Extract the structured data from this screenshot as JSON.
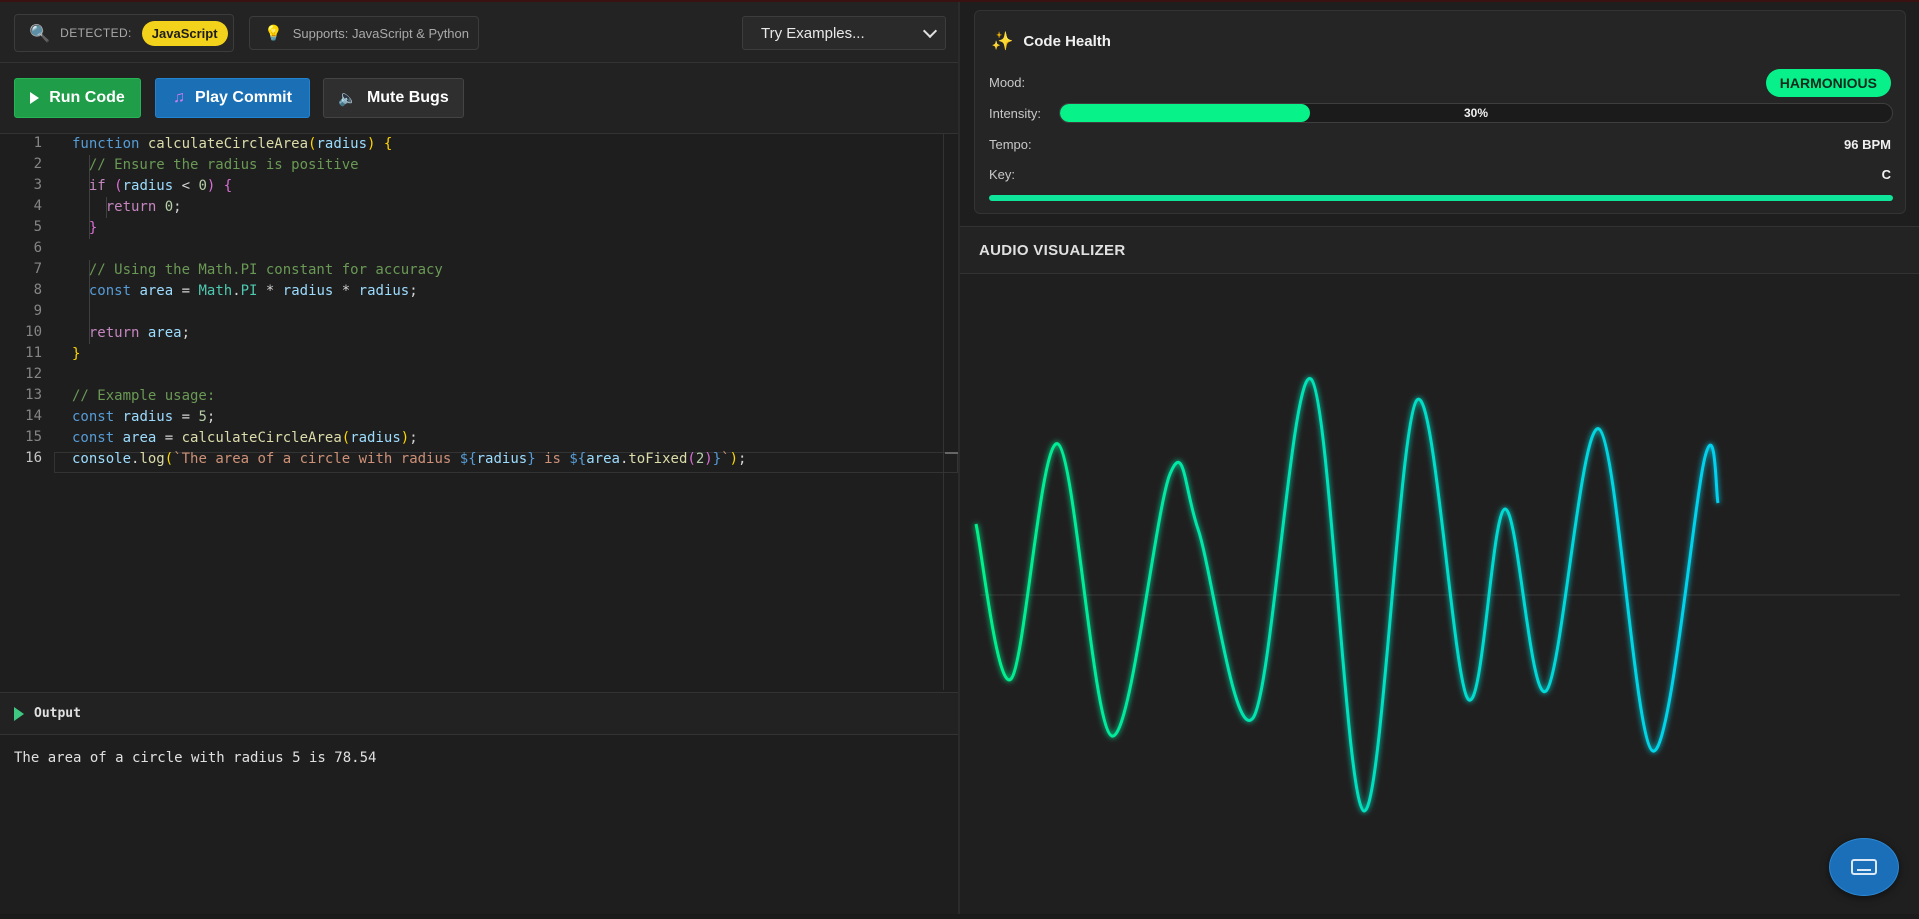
{
  "toolbar_top": {
    "detected_label": "DETECTED:",
    "detected_language": "JavaScript",
    "supports_label": "Supports: JavaScript & Python",
    "examples_select": "Try Examples..."
  },
  "actions": {
    "run": "Run Code",
    "play": "Play Commit",
    "mute": "Mute Bugs"
  },
  "editor": {
    "line_numbers": [
      "1",
      "2",
      "3",
      "4",
      "5",
      "6",
      "7",
      "8",
      "9",
      "10",
      "11",
      "12",
      "13",
      "14",
      "15",
      "16"
    ],
    "active_line": 16
  },
  "output": {
    "title": "Output",
    "text": "The area of a circle with radius 5 is 78.54"
  },
  "code_health": {
    "title": "Code Health",
    "mood_label": "Mood:",
    "mood_value": "HARMONIOUS",
    "intensity_label": "Intensity:",
    "intensity_value": "30%",
    "intensity_fraction": 0.3,
    "tempo_label": "Tempo:",
    "tempo_value": "96 BPM",
    "key_label": "Key:",
    "key_value": "C"
  },
  "visualizer": {
    "title": "AUDIO VISUALIZER",
    "color_start": "#00f08a",
    "color_end": "#00d2f0"
  },
  "colors": {
    "accent_green": "#07f08a",
    "run_button": "#1f9d48",
    "play_button": "#1a6fb5",
    "language_badge": "#f3d21c"
  },
  "icons": {
    "detect": "magnifier-icon",
    "supports": "lightbulb-icon",
    "play": "music-note-icon",
    "mute": "speaker-icon",
    "health": "sparkle-icon",
    "keyboard": "keyboard-icon"
  }
}
